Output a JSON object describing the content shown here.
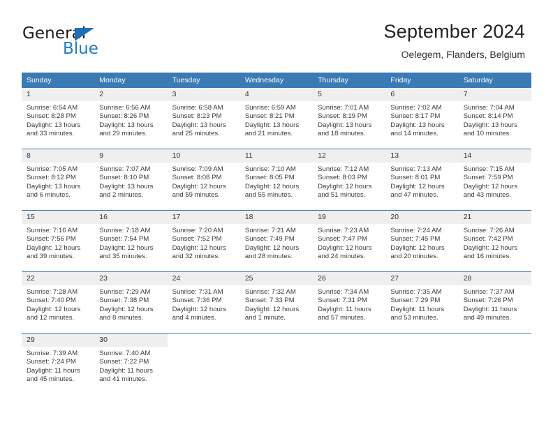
{
  "brand": {
    "name_top": "General",
    "name_bottom": "Blue",
    "triangle_icon": "triangle-icon",
    "color_blue": "#1f7ac4"
  },
  "header": {
    "title": "September 2024",
    "subtitle": "Oelegem, Flanders, Belgium"
  },
  "colors": {
    "header_blue": "#3a7ab5",
    "daynum_gray": "#efefef",
    "text": "#333333"
  },
  "calendar": {
    "weekday_headers": [
      "Sunday",
      "Monday",
      "Tuesday",
      "Wednesday",
      "Thursday",
      "Friday",
      "Saturday"
    ],
    "weeks": [
      [
        {
          "day": "1",
          "sunrise": "Sunrise: 6:54 AM",
          "sunset": "Sunset: 8:28 PM",
          "daylight_1": "Daylight: 13 hours",
          "daylight_2": "and 33 minutes."
        },
        {
          "day": "2",
          "sunrise": "Sunrise: 6:56 AM",
          "sunset": "Sunset: 8:26 PM",
          "daylight_1": "Daylight: 13 hours",
          "daylight_2": "and 29 minutes."
        },
        {
          "day": "3",
          "sunrise": "Sunrise: 6:58 AM",
          "sunset": "Sunset: 8:23 PM",
          "daylight_1": "Daylight: 13 hours",
          "daylight_2": "and 25 minutes."
        },
        {
          "day": "4",
          "sunrise": "Sunrise: 6:59 AM",
          "sunset": "Sunset: 8:21 PM",
          "daylight_1": "Daylight: 13 hours",
          "daylight_2": "and 21 minutes."
        },
        {
          "day": "5",
          "sunrise": "Sunrise: 7:01 AM",
          "sunset": "Sunset: 8:19 PM",
          "daylight_1": "Daylight: 13 hours",
          "daylight_2": "and 18 minutes."
        },
        {
          "day": "6",
          "sunrise": "Sunrise: 7:02 AM",
          "sunset": "Sunset: 8:17 PM",
          "daylight_1": "Daylight: 13 hours",
          "daylight_2": "and 14 minutes."
        },
        {
          "day": "7",
          "sunrise": "Sunrise: 7:04 AM",
          "sunset": "Sunset: 8:14 PM",
          "daylight_1": "Daylight: 13 hours",
          "daylight_2": "and 10 minutes."
        }
      ],
      [
        {
          "day": "8",
          "sunrise": "Sunrise: 7:05 AM",
          "sunset": "Sunset: 8:12 PM",
          "daylight_1": "Daylight: 13 hours",
          "daylight_2": "and 6 minutes."
        },
        {
          "day": "9",
          "sunrise": "Sunrise: 7:07 AM",
          "sunset": "Sunset: 8:10 PM",
          "daylight_1": "Daylight: 13 hours",
          "daylight_2": "and 2 minutes."
        },
        {
          "day": "10",
          "sunrise": "Sunrise: 7:09 AM",
          "sunset": "Sunset: 8:08 PM",
          "daylight_1": "Daylight: 12 hours",
          "daylight_2": "and 59 minutes."
        },
        {
          "day": "11",
          "sunrise": "Sunrise: 7:10 AM",
          "sunset": "Sunset: 8:05 PM",
          "daylight_1": "Daylight: 12 hours",
          "daylight_2": "and 55 minutes."
        },
        {
          "day": "12",
          "sunrise": "Sunrise: 7:12 AM",
          "sunset": "Sunset: 8:03 PM",
          "daylight_1": "Daylight: 12 hours",
          "daylight_2": "and 51 minutes."
        },
        {
          "day": "13",
          "sunrise": "Sunrise: 7:13 AM",
          "sunset": "Sunset: 8:01 PM",
          "daylight_1": "Daylight: 12 hours",
          "daylight_2": "and 47 minutes."
        },
        {
          "day": "14",
          "sunrise": "Sunrise: 7:15 AM",
          "sunset": "Sunset: 7:59 PM",
          "daylight_1": "Daylight: 12 hours",
          "daylight_2": "and 43 minutes."
        }
      ],
      [
        {
          "day": "15",
          "sunrise": "Sunrise: 7:16 AM",
          "sunset": "Sunset: 7:56 PM",
          "daylight_1": "Daylight: 12 hours",
          "daylight_2": "and 39 minutes."
        },
        {
          "day": "16",
          "sunrise": "Sunrise: 7:18 AM",
          "sunset": "Sunset: 7:54 PM",
          "daylight_1": "Daylight: 12 hours",
          "daylight_2": "and 35 minutes."
        },
        {
          "day": "17",
          "sunrise": "Sunrise: 7:20 AM",
          "sunset": "Sunset: 7:52 PM",
          "daylight_1": "Daylight: 12 hours",
          "daylight_2": "and 32 minutes."
        },
        {
          "day": "18",
          "sunrise": "Sunrise: 7:21 AM",
          "sunset": "Sunset: 7:49 PM",
          "daylight_1": "Daylight: 12 hours",
          "daylight_2": "and 28 minutes."
        },
        {
          "day": "19",
          "sunrise": "Sunrise: 7:23 AM",
          "sunset": "Sunset: 7:47 PM",
          "daylight_1": "Daylight: 12 hours",
          "daylight_2": "and 24 minutes."
        },
        {
          "day": "20",
          "sunrise": "Sunrise: 7:24 AM",
          "sunset": "Sunset: 7:45 PM",
          "daylight_1": "Daylight: 12 hours",
          "daylight_2": "and 20 minutes."
        },
        {
          "day": "21",
          "sunrise": "Sunrise: 7:26 AM",
          "sunset": "Sunset: 7:42 PM",
          "daylight_1": "Daylight: 12 hours",
          "daylight_2": "and 16 minutes."
        }
      ],
      [
        {
          "day": "22",
          "sunrise": "Sunrise: 7:28 AM",
          "sunset": "Sunset: 7:40 PM",
          "daylight_1": "Daylight: 12 hours",
          "daylight_2": "and 12 minutes."
        },
        {
          "day": "23",
          "sunrise": "Sunrise: 7:29 AM",
          "sunset": "Sunset: 7:38 PM",
          "daylight_1": "Daylight: 12 hours",
          "daylight_2": "and 8 minutes."
        },
        {
          "day": "24",
          "sunrise": "Sunrise: 7:31 AM",
          "sunset": "Sunset: 7:36 PM",
          "daylight_1": "Daylight: 12 hours",
          "daylight_2": "and 4 minutes."
        },
        {
          "day": "25",
          "sunrise": "Sunrise: 7:32 AM",
          "sunset": "Sunset: 7:33 PM",
          "daylight_1": "Daylight: 12 hours",
          "daylight_2": "and 1 minute."
        },
        {
          "day": "26",
          "sunrise": "Sunrise: 7:34 AM",
          "sunset": "Sunset: 7:31 PM",
          "daylight_1": "Daylight: 11 hours",
          "daylight_2": "and 57 minutes."
        },
        {
          "day": "27",
          "sunrise": "Sunrise: 7:35 AM",
          "sunset": "Sunset: 7:29 PM",
          "daylight_1": "Daylight: 11 hours",
          "daylight_2": "and 53 minutes."
        },
        {
          "day": "28",
          "sunrise": "Sunrise: 7:37 AM",
          "sunset": "Sunset: 7:26 PM",
          "daylight_1": "Daylight: 11 hours",
          "daylight_2": "and 49 minutes."
        }
      ],
      [
        {
          "day": "29",
          "sunrise": "Sunrise: 7:39 AM",
          "sunset": "Sunset: 7:24 PM",
          "daylight_1": "Daylight: 11 hours",
          "daylight_2": "and 45 minutes."
        },
        {
          "day": "30",
          "sunrise": "Sunrise: 7:40 AM",
          "sunset": "Sunset: 7:22 PM",
          "daylight_1": "Daylight: 11 hours",
          "daylight_2": "and 41 minutes."
        },
        {
          "day": "",
          "sunrise": "",
          "sunset": "",
          "daylight_1": "",
          "daylight_2": ""
        },
        {
          "day": "",
          "sunrise": "",
          "sunset": "",
          "daylight_1": "",
          "daylight_2": ""
        },
        {
          "day": "",
          "sunrise": "",
          "sunset": "",
          "daylight_1": "",
          "daylight_2": ""
        },
        {
          "day": "",
          "sunrise": "",
          "sunset": "",
          "daylight_1": "",
          "daylight_2": ""
        },
        {
          "day": "",
          "sunrise": "",
          "sunset": "",
          "daylight_1": "",
          "daylight_2": ""
        }
      ]
    ]
  }
}
